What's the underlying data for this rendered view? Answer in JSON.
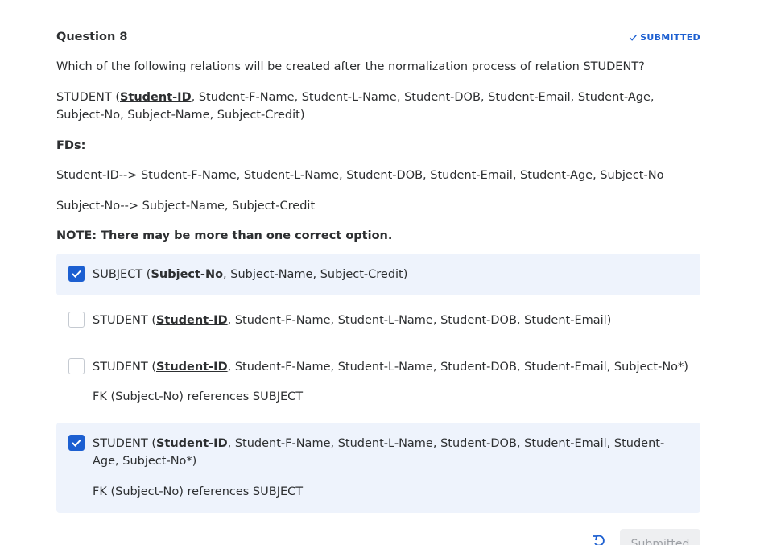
{
  "question": {
    "title": "Question 8",
    "status": "SUBMITTED",
    "prompt": "Which of the following relations will be created after the normalization process of relation STUDENT?",
    "relation": {
      "name_open": "STUDENT (",
      "key": "Student-ID",
      "rest": ", Student-F-Name, Student-L-Name, Student-DOB, Student-Email, Student-Age, Subject-No, Subject-Name, Subject-Credit)"
    },
    "fds_label": "FDs:",
    "fd1": "Student-ID--> Student-F-Name, Student-L-Name, Student-DOB, Student-Email, Student-Age, Subject-No",
    "fd2": "Subject-No--> Subject-Name, Subject-Credit",
    "note": "NOTE: There may be more than one correct option."
  },
  "options": [
    {
      "selected": true,
      "prefix": "SUBJECT (",
      "key": "Subject-No",
      "rest": ", Subject-Name, Subject-Credit)",
      "fk": ""
    },
    {
      "selected": false,
      "prefix": "STUDENT (",
      "key": "Student-ID",
      "rest": ", Student-F-Name, Student-L-Name, Student-DOB, Student-Email)",
      "fk": ""
    },
    {
      "selected": false,
      "prefix": "STUDENT (",
      "key": "Student-ID",
      "rest": ", Student-F-Name, Student-L-Name, Student-DOB, Student-Email, Subject-No*)",
      "fk": "FK (Subject-No) references SUBJECT"
    },
    {
      "selected": true,
      "prefix": "STUDENT (",
      "key": "Student-ID",
      "rest": ", Student-F-Name, Student-L-Name, Student-DOB, Student-Email, Student-Age, Subject-No*)",
      "fk": "FK (Subject-No) references SUBJECT"
    }
  ],
  "footer": {
    "undo_icon": "undo-icon",
    "submit_label": "Submitted"
  },
  "colors": {
    "accent": "#1c5fd1",
    "selected_bg": "#eef3fc",
    "text": "#2d2f31"
  }
}
